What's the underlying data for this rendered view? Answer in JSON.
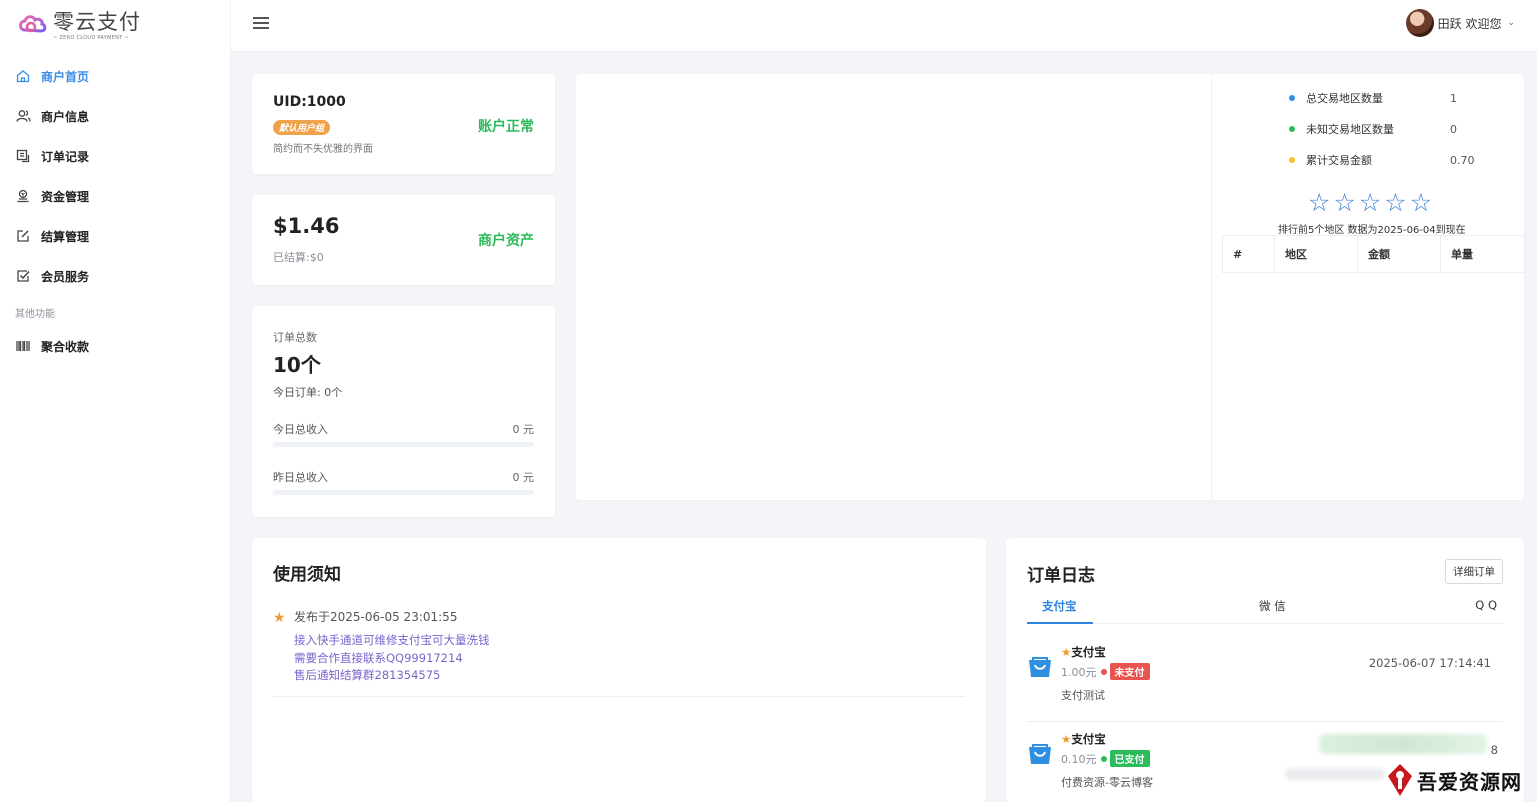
{
  "brand": {
    "name": "零云支付",
    "tagline": "~ ZERO CLOUD PAYMENT ~"
  },
  "nav": {
    "items": [
      {
        "label": "商户首页",
        "icon": "home-icon"
      },
      {
        "label": "商户信息",
        "icon": "users-icon"
      },
      {
        "label": "订单记录",
        "icon": "order-icon"
      },
      {
        "label": "资金管理",
        "icon": "wallet-icon"
      },
      {
        "label": "结算管理",
        "icon": "edit-icon"
      },
      {
        "label": "会员服务",
        "icon": "check-square-icon"
      }
    ],
    "section_label": "其他功能",
    "extra_items": [
      {
        "label": "聚合收款",
        "icon": "barcode-icon"
      }
    ]
  },
  "topbar": {
    "user_label": "田跃 欢迎您"
  },
  "account": {
    "uid": "UID:1000",
    "group": "默认用户组",
    "slogan": "简约而不失优雅的界面",
    "status": "账户正常"
  },
  "assets": {
    "balance": "$1.46",
    "settled": "已结算:$0",
    "label": "商户资产"
  },
  "orders_summary": {
    "label": "订单总数",
    "total": "10个",
    "today_orders": "今日订单:  0个",
    "today_income_label": "今日总收入",
    "today_income_value": "0 元",
    "yesterday_income_label": "昨日总收入",
    "yesterday_income_value": "0 元",
    "today_income_progress": 0,
    "yesterday_income_progress": 0
  },
  "region_stats": {
    "legend": [
      {
        "label": "总交易地区数量",
        "value": "1",
        "color": "#2f8fe0"
      },
      {
        "label": "未知交易地区数量",
        "value": "0",
        "color": "#2cbb5a"
      },
      {
        "label": "累计交易金额",
        "value": "0.70",
        "color": "#f2c230"
      }
    ],
    "rating": 0,
    "rank_note": "排行前5个地区  数据为2025-06-04到现在",
    "table_headers": [
      "#",
      "地区",
      "金额",
      "单量"
    ]
  },
  "notice": {
    "title": "使用须知",
    "date": "发布于2025-06-05 23:01:55",
    "lines": [
      "接入快手通道可维修支付宝可大量洗钱",
      "需要合作直接联系QQ99917214",
      "售后通知结算群281354575"
    ]
  },
  "order_log": {
    "title": "订单日志",
    "detail_button": "详细订单",
    "tabs": [
      "支付宝",
      "微 信",
      "Q Q"
    ],
    "items": [
      {
        "name": "支付宝",
        "amount": "1.00元",
        "status": "未支付",
        "status_color": "#e8554e",
        "dot_color": "#e8554e",
        "desc": "支付测试",
        "time": "2025-06-07 17:14:41"
      },
      {
        "name": "支付宝",
        "amount": "0.10元",
        "status": "已支付",
        "status_color": "#2cbb5a",
        "dot_color": "#2cbb5a",
        "desc": "付费资源-零云博客",
        "time": "8"
      }
    ]
  },
  "watermark": {
    "text": "吾爱资源网"
  }
}
